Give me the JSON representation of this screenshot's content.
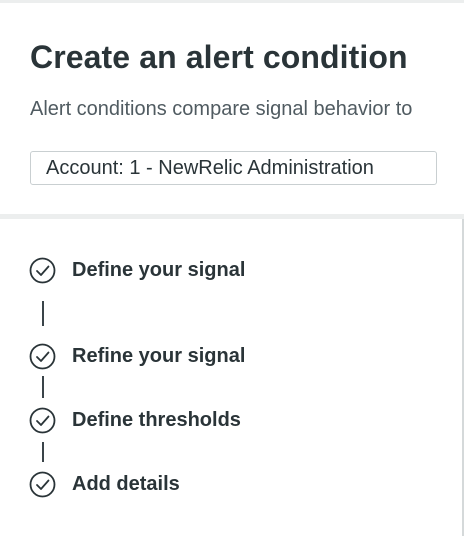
{
  "header": {
    "title": "Create an alert condition",
    "subtitle": "Alert conditions compare signal behavior to",
    "account_label": "Account: 1 - NewRelic Administration"
  },
  "steps": [
    {
      "label": "Define your signal",
      "icon": "check-circle-icon",
      "state": "complete"
    },
    {
      "label": "Refine your signal",
      "icon": "check-circle-icon",
      "state": "complete"
    },
    {
      "label": "Define thresholds",
      "icon": "check-circle-icon",
      "state": "complete"
    },
    {
      "label": "Add details",
      "icon": "check-circle-icon",
      "state": "complete"
    }
  ],
  "colors": {
    "text_primary": "#2a3438",
    "text_secondary": "#505b61",
    "border": "#c9cfd1",
    "background": "#f4f5f5"
  }
}
